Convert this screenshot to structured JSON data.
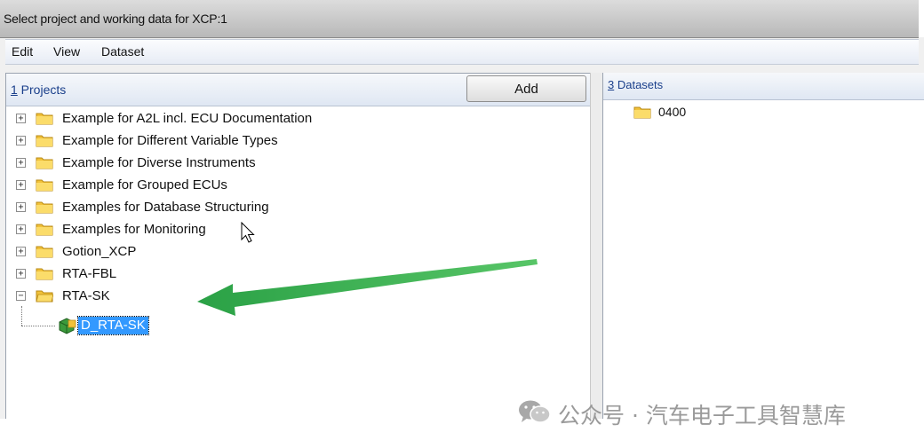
{
  "window": {
    "title": "Select project and working data for XCP:1"
  },
  "menu": {
    "items": [
      "Edit",
      "View",
      "Dataset"
    ]
  },
  "projects_panel": {
    "header_num": "1",
    "header_text": " Projects",
    "add_label": "Add",
    "items": [
      {
        "label": "Example for A2L incl. ECU Documentation",
        "expander": "+"
      },
      {
        "label": "Example for Different Variable Types",
        "expander": "+"
      },
      {
        "label": "Example for Diverse Instruments",
        "expander": "+"
      },
      {
        "label": "Example for Grouped ECUs",
        "expander": "+"
      },
      {
        "label": "Examples for Database Structuring",
        "expander": "+"
      },
      {
        "label": "Examples for Monitoring",
        "expander": "+"
      },
      {
        "label": "Gotion_XCP",
        "expander": "+"
      },
      {
        "label": "RTA-FBL",
        "expander": "+"
      },
      {
        "label": "RTA-SK",
        "expander": "−"
      }
    ],
    "selected_child": {
      "label": "D_RTA-SK"
    }
  },
  "datasets_panel": {
    "header_num": "3",
    "header_text": " Datasets",
    "items": [
      {
        "label": "0400"
      }
    ]
  },
  "watermark": {
    "text": "公众号 · 汽车电子工具智慧库"
  },
  "colors": {
    "selection": "#3399ff",
    "arrow": "#2db34a",
    "folder": "#f2c23a"
  },
  "icons": {
    "folder": "folder-icon",
    "project": "green-project-icon",
    "cursor": "mouse-cursor-icon",
    "arrow": "green-arrow-annotation",
    "watermark": "wechat-icon"
  }
}
